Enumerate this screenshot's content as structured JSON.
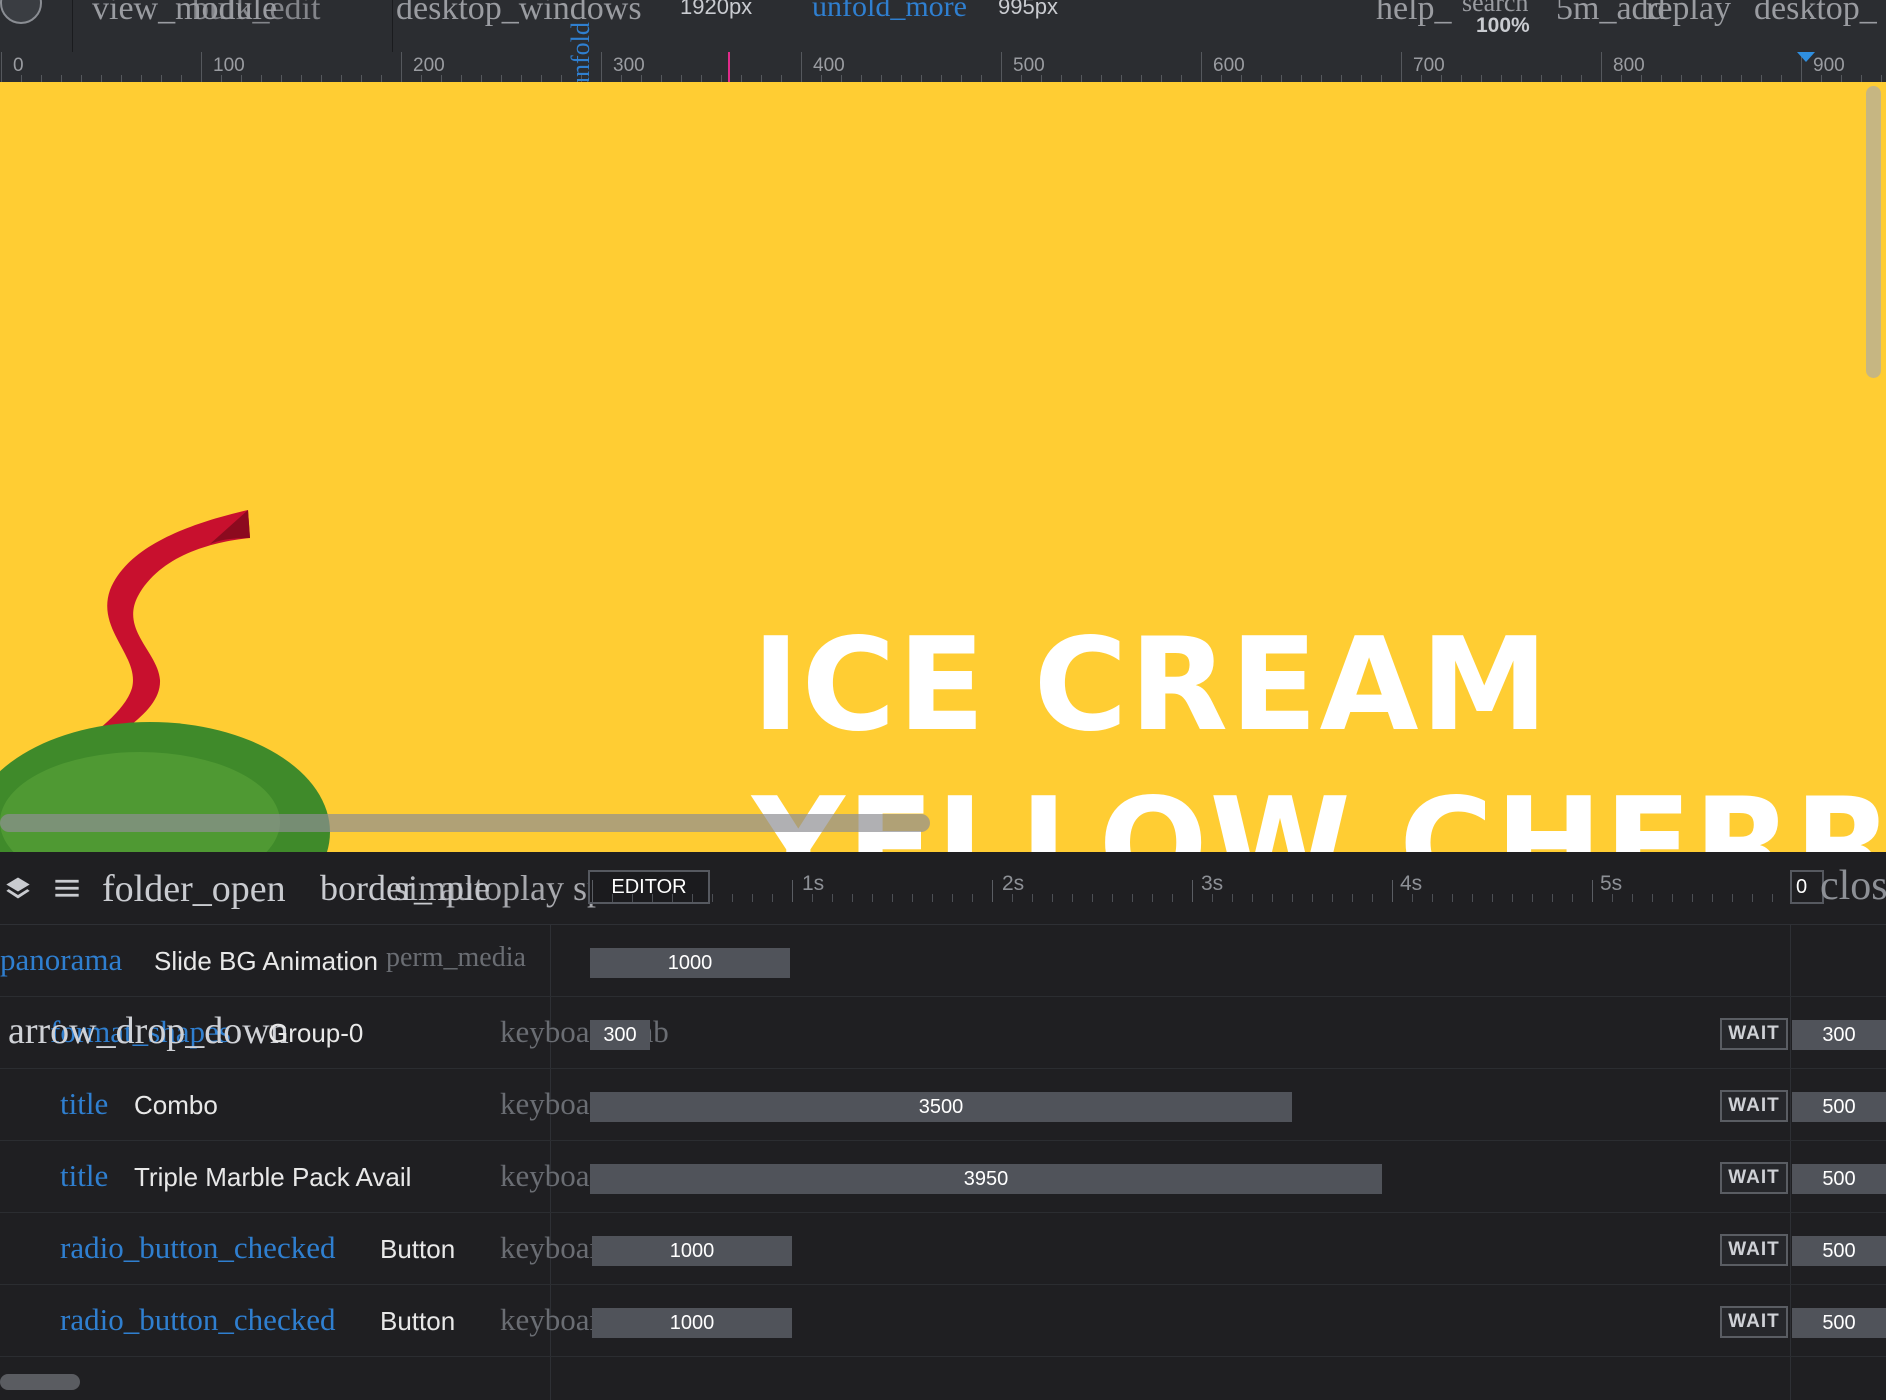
{
  "topbar": {
    "ligature_view": "view_module",
    "ligature_bulk": "bulk_edit",
    "ligature_desktop": "desktop_windows",
    "width_value": "1920px",
    "ligature_unfold": "unfold_more",
    "height_value": "995px",
    "ligature_unfold_vertical": "unfold",
    "ligature_help": "help_",
    "ligature_search": "search",
    "zoom_value": "100%",
    "ligature_5m_add": "5m_add",
    "ligature_replay": "replay",
    "ligature_desktop2": "desktop_"
  },
  "ruler": {
    "labels": [
      "0",
      "100",
      "200",
      "300",
      "400",
      "500",
      "600",
      "700",
      "800",
      "900"
    ]
  },
  "canvas": {
    "title_line1": "ICE CREAM",
    "title_line2": "YELLOW CHERRY",
    "background_color": "#ffcd33"
  },
  "timeline": {
    "ligature_layers": "layers",
    "ligature_menu": "menu",
    "ligature_folder": "folder_open",
    "ligature_border": "border_",
    "ligature_simple": "simple",
    "ligature_speed": "autoplay speed",
    "editor_label": "EDITOR",
    "time_labels": [
      "1s",
      "2s",
      "3s",
      "4s",
      "5s"
    ],
    "end_value": "0",
    "ligature_close": "close",
    "rows": [
      {
        "icon": "panorama",
        "name": "Slide BG Animation",
        "kbd": "perm_media",
        "bar": "1000",
        "wait": "",
        "wait_value": ""
      },
      {
        "icon": "format_shapes",
        "icon2": "arrow_drop_down",
        "name": "Group-0",
        "kbd": "keyboard_tab",
        "bar": "300",
        "wait": "WAIT",
        "wait_value": "300"
      },
      {
        "icon": "title",
        "name": "Combo",
        "kbd": "keyboard_tab",
        "bar": "3500",
        "wait": "WAIT",
        "wait_value": "500"
      },
      {
        "icon": "title",
        "name": "Triple Marble Pack Avail",
        "kbd": "keyboard_tab",
        "bar": "3950",
        "wait": "WAIT",
        "wait_value": "500"
      },
      {
        "icon": "radio_button_checked",
        "name": "Button",
        "kbd": "keyboard_tab",
        "bar": "1000",
        "wait": "WAIT",
        "wait_value": "500"
      },
      {
        "icon": "radio_button_checked",
        "name": "Button",
        "kbd": "keyboard_tab",
        "bar": "1000",
        "wait": "WAIT",
        "wait_value": "500"
      }
    ]
  },
  "colors": {
    "accent_blue": "#2f7fd0",
    "ruler_marker": "#e02a8a",
    "ribbon_red": "#c8102e",
    "leaf_green": "#3f8a2a"
  }
}
